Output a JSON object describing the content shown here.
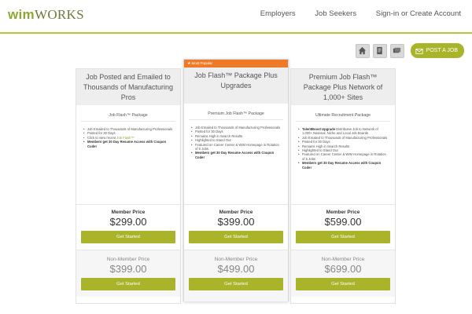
{
  "logo": {
    "part1": "wim",
    "part2": "WORKS"
  },
  "nav": {
    "employers": "Employers",
    "job_seekers": "Job Seekers",
    "signin": "Sign-in or Create Account"
  },
  "toolbar": {
    "post_job": "POST A JOB"
  },
  "icons": {
    "home": "home-icon",
    "doc": "document-icon",
    "cards": "cards-icon",
    "post": "post-job-icon"
  },
  "colors": {
    "accent": "#a9b42b",
    "badge": "#ee7a28",
    "rule": "#b4c53a"
  },
  "cards": [
    {
      "title": "Job Posted and Emailed to Thousands of Manufacturing Pros",
      "subtitle": "Job Flash™ Package",
      "features": [
        "Job Emailed to Thousands of Manufacturing Professionals",
        "Posted for 30 Days",
        "Click to view recent ",
        "Members get 30 Day Resume Access with Coupon Code!"
      ],
      "feature_link": "Job Flash™",
      "member_label": "Member Price",
      "member_price": "$299.00",
      "member_button": "Get Started",
      "nonmember_label": "Non-Member Price",
      "nonmember_price": "$399.00",
      "nonmember_button": "Get Started"
    },
    {
      "badge": "Most Popular",
      "title": "Job Flash™ Package Plus Upgrades",
      "subtitle": "Premium Job Flash™ Package",
      "features": [
        "Job Emailed to Thousands of Manufacturing Professionals",
        "Posted for 30 Days",
        "Remains High in Search Results",
        "Highlighted to Stand Out",
        "Featured on Career Center & WIM Homepage in Rotation of 5 Jobs",
        "Members get 30 Day Resume Access with Coupon Code!"
      ],
      "member_label": "Member Price",
      "member_price": "$399.00",
      "member_button": "Get Started",
      "nonmember_label": "Non-Member Price",
      "nonmember_price": "$499.00",
      "nonmember_button": "Get Started"
    },
    {
      "title": "Premium Job Flash™ Package Plus Network of 1,000+ Sites",
      "subtitle": "Ultimate Recruitment Package",
      "features_lead_bold": "TalentBoost Upgrade",
      "features": [
        " Distributes Job to Network of 1,000+ National, Niche and Local Job Boards",
        "Job Emailed to Thousands of Manufacturing Professionals",
        "Posted for 30 Days",
        "Remains High in Search Results",
        "Highlighted to Stand Out",
        "Featured on Career Center & WIM Homepage in Rotation of 5 Jobs",
        "Members get 30 Day Resume Access with Coupon Code!"
      ],
      "member_label": "Member Price",
      "member_price": "$599.00",
      "member_button": "Get Started",
      "nonmember_label": "Non-Member Price",
      "nonmember_price": "$699.00",
      "nonmember_button": "Get Started"
    }
  ]
}
